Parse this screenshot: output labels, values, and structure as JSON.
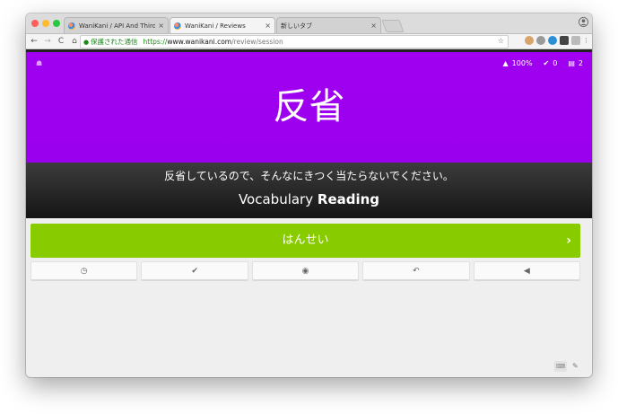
{
  "browser": {
    "tabs": [
      {
        "title": "WaniKani / API And Third-Part",
        "close": "×"
      },
      {
        "title": "WaniKani / Reviews",
        "close": "×"
      },
      {
        "title": "新しいタブ",
        "close": "×"
      }
    ],
    "toolbar": {
      "back": "←",
      "forward": "→",
      "reload": "C",
      "home": "⌂",
      "secure_text": "保護された通信",
      "url_scheme": "https://",
      "url_host": "www.wanikani.com",
      "url_path": "/review/session",
      "star": "☆"
    },
    "extension_icons": [
      "ext-1-icon",
      "ext-2-icon",
      "ext-3-icon",
      "ext-4-icon",
      "ext-camera-icon",
      "menu-icon"
    ]
  },
  "review": {
    "stats": {
      "percent_correct": "100%",
      "done": "0",
      "remaining": "2"
    },
    "character": "反省",
    "meaning_prompt": "反省しているので、そんなにきつく当たらないでください。",
    "question_type": "Vocabulary",
    "question_kind": "Reading",
    "answer_value": "はんせい",
    "colors": {
      "header": "#a100f0",
      "answer_bar": "#88cc00"
    },
    "actions": [
      "last-items-icon",
      "correct-icon",
      "view-info-icon",
      "undo-icon",
      "audio-icon"
    ]
  }
}
